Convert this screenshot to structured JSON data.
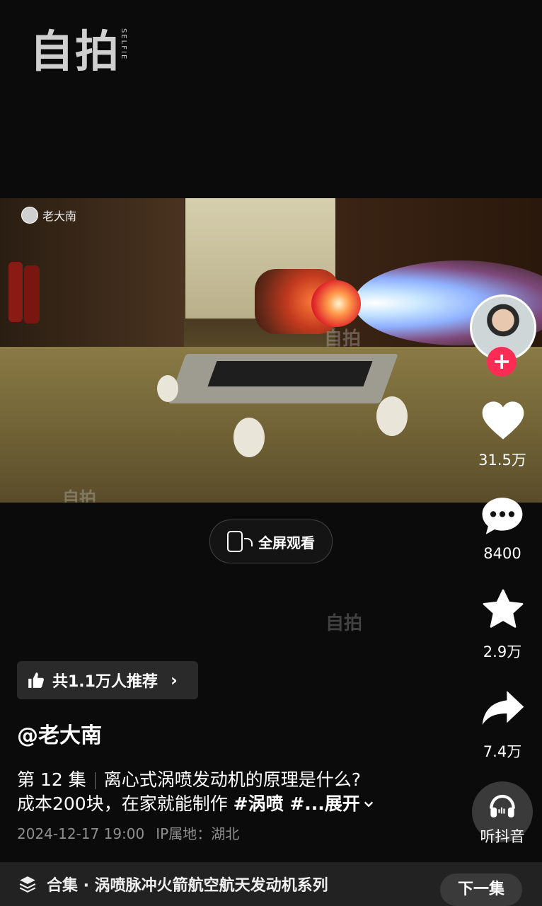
{
  "top_logo": {
    "text": "自拍",
    "sub": "SELFIE"
  },
  "video": {
    "author_badge": "老大南",
    "watermark": "自拍"
  },
  "fullscreen_button": {
    "label": "全屏观看"
  },
  "rail": {
    "like_count": "31.5万",
    "comment_count": "8400",
    "favorite_count": "2.9万",
    "share_count": "7.4万",
    "listen_label": "听抖音",
    "follow_symbol": "+"
  },
  "recommend": {
    "label": "共1.1万人推荐",
    "chevron": "›"
  },
  "author": "@老大南",
  "description": {
    "episode": "第 12 集",
    "line1": "离心式涡喷发动机的原理是什么?",
    "line2_text": "成本200块，在家就能制作 ",
    "line2_tags": "#涡喷 #...",
    "expand": "展开"
  },
  "meta": {
    "time": "2024-12-17 19:00",
    "ip": "IP属地：湖北"
  },
  "collection": {
    "title": "合集 · 涡喷脉冲火箭航空航天发动机系列",
    "next": "下一集"
  },
  "colors": {
    "follow": "#fe2c55",
    "background": "#0b0b0b"
  }
}
